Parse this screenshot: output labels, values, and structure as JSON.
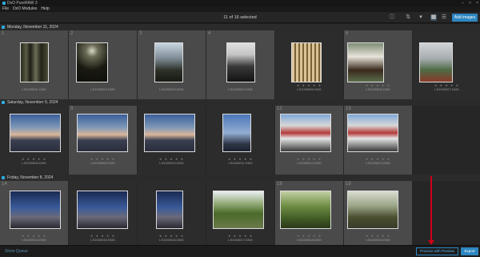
{
  "app": {
    "title": "DxO PureRAW 3"
  },
  "menu": [
    "File",
    "DxO Modules",
    "Help"
  ],
  "toolbar": {
    "selection_count": "11 of 16 selected",
    "add_images_label": "Add images",
    "icons": [
      "info-icon",
      "sort-icon",
      "filter-icon",
      "grid-icon",
      "list-icon"
    ]
  },
  "groups": [
    {
      "header": "Monday, November 11, 2024",
      "items": [
        {
          "num": "1",
          "file": "LS1000001.DNG",
          "selected": true,
          "stars": "",
          "scene": "trees-vertical"
        },
        {
          "num": "2",
          "file": "LS1000002.DNG",
          "selected": true,
          "stars": "",
          "scene": "forest-canopy"
        },
        {
          "num": "3",
          "file": "LS1000003.DNG",
          "selected": true,
          "stars": "",
          "scene": "tree-silhouette"
        },
        {
          "num": "4",
          "file": "LS1000004.DNG",
          "selected": true,
          "stars": "",
          "scene": "dark-tree"
        },
        {
          "num": "",
          "file": "LS1000005.DNG",
          "selected": false,
          "stars": "★ ★ ★ ★ ★",
          "scene": "plaques"
        },
        {
          "num": "6",
          "file": "LS1000006.DNG",
          "selected": true,
          "stars": "★ ★ ★ ★ ★",
          "scene": "sign"
        },
        {
          "num": "",
          "file": "LS1000007.DNG",
          "selected": false,
          "stars": "★ ★ ★ ★ ★",
          "scene": "mountain-fog"
        }
      ]
    },
    {
      "header": "Saturday, November 9, 2024",
      "items": [
        {
          "num": "",
          "file": "LS1000008.DNG",
          "selected": false,
          "stars": "★ ★ ★ ★ ★",
          "scene": "fuji"
        },
        {
          "num": "9",
          "file": "LS1000009.DNG",
          "selected": true,
          "stars": "★ ★ ★ ★ ★",
          "scene": "fuji"
        },
        {
          "num": "",
          "file": "LS1000010.DNG",
          "selected": false,
          "stars": "★ ★ ★ ★ ★",
          "scene": "fuji"
        },
        {
          "num": "",
          "file": "LS1000011.DNG",
          "selected": false,
          "stars": "★ ★ ★ ★ ★",
          "scene": "city-dusk"
        },
        {
          "num": "12",
          "file": "LS1000012.DNG",
          "selected": true,
          "stars": "★ ★ ★ ★ ★",
          "scene": "building"
        },
        {
          "num": "13",
          "file": "LS1000013.DNG",
          "selected": true,
          "stars": "★ ★ ★ ★ ★",
          "scene": "building"
        }
      ]
    },
    {
      "header": "Friday, November 8, 2024",
      "items": [
        {
          "num": "14",
          "file": "LS1000014.DNG",
          "selected": true,
          "stars": "★ ★ ★ ★ ★",
          "scene": "night-city"
        },
        {
          "num": "",
          "file": "LS1000015.DNG",
          "selected": false,
          "stars": "★ ★ ★ ★ ★",
          "scene": "night-city"
        },
        {
          "num": "",
          "file": "LS1000016.DNG",
          "selected": false,
          "stars": "★ ★ ★ ★ ★",
          "scene": "night-city"
        },
        {
          "num": "",
          "file": "LS1000017.DNG",
          "selected": false,
          "stars": "★ ★ ★ ★ ★",
          "scene": "bonsai"
        },
        {
          "num": "18",
          "file": "LS1000018.DNG",
          "selected": true,
          "stars": "★ ★ ★ ★ ★",
          "scene": "garden"
        },
        {
          "num": "19",
          "file": "LS1000019.DNG",
          "selected": true,
          "stars": "★ ★ ★ ★ ★",
          "scene": "orchard"
        }
      ]
    }
  ],
  "bottom": {
    "show_queue": "Show Queue",
    "process_label": "Process with Preview",
    "export_label": "Export"
  },
  "colors": {
    "accent": "#2d86c0",
    "annotation": "#d0001a"
  }
}
